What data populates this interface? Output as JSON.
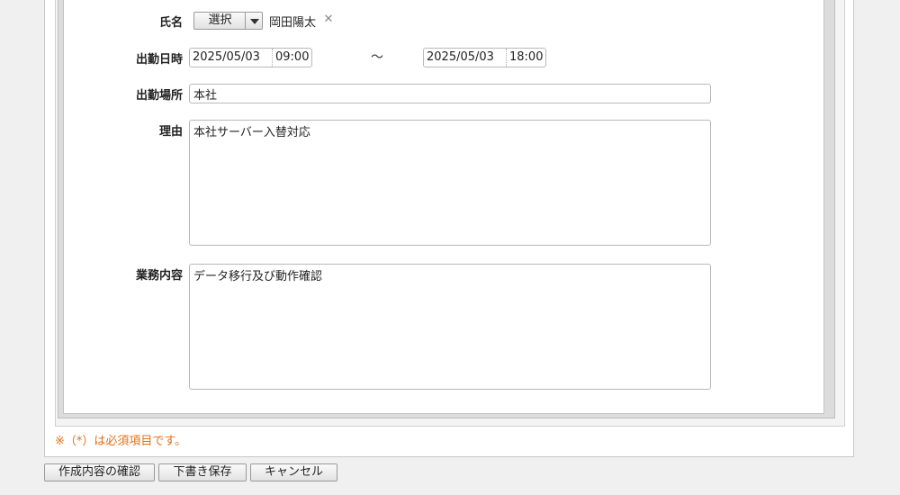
{
  "form": {
    "name": {
      "label": "氏名",
      "select_label": "選択",
      "value": "岡田陽太",
      "clear_icon": "close-icon"
    },
    "attendance_datetime": {
      "label": "出勤日時",
      "start_date": "2025/05/03",
      "start_time": "09:00",
      "separator": "～",
      "end_date": "2025/05/03",
      "end_time": "18:00"
    },
    "location": {
      "label": "出勤場所",
      "value": "本社"
    },
    "reason": {
      "label": "理由",
      "value": "本社サーバー入替対応"
    },
    "work_content": {
      "label": "業務内容",
      "value": "データ移行及び動作確認"
    }
  },
  "required_note": "※（*）は必須項目です。",
  "actions": {
    "confirm_label": "作成内容の確認",
    "draft_label": "下書き保存",
    "cancel_label": "キャンセル"
  },
  "colors": {
    "required_note": "#e0701a",
    "background": "#f0f0f0"
  }
}
